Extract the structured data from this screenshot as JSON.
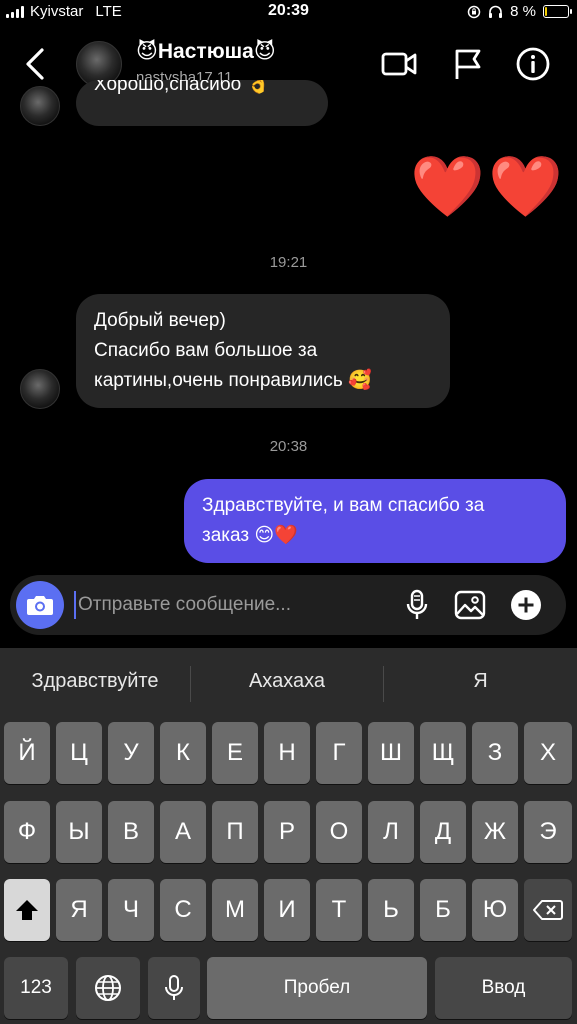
{
  "status_bar": {
    "carrier": "Kyivstar",
    "network": "LTE",
    "time": "20:39",
    "battery_text": "8 %",
    "battery_level_percent": 8
  },
  "header": {
    "contact_name": "😈Настюша😈",
    "contact_handle": "nastysha17.11"
  },
  "chat": {
    "partial_message": "Хорошо,спасибо 👌",
    "hearts": "❤️",
    "time_1": "19:21",
    "incoming_line1": "Добрый вечер)",
    "incoming_line2": "Спасибо вам большое за",
    "incoming_line3": "картины,очень понравились 🥰",
    "time_2": "20:38",
    "outgoing_line1": "Здравствуйте, и вам спасибо за",
    "outgoing_line2": "заказ 😊❤️"
  },
  "composer": {
    "placeholder": "Отправьте сообщение..."
  },
  "keyboard": {
    "suggestions": [
      "Здравствуйте",
      "Ахахаха",
      "Я"
    ],
    "row1": [
      "Й",
      "Ц",
      "У",
      "К",
      "Е",
      "Н",
      "Г",
      "Ш",
      "Щ",
      "З",
      "Х"
    ],
    "row2": [
      "Ф",
      "Ы",
      "В",
      "А",
      "П",
      "Р",
      "О",
      "Л",
      "Д",
      "Ж",
      "Э"
    ],
    "row3": [
      "Я",
      "Ч",
      "С",
      "М",
      "И",
      "Т",
      "Ь",
      "Б",
      "Ю"
    ],
    "numbers_key": "123",
    "space_key": "Пробел",
    "return_key": "Ввод"
  },
  "icons": {
    "back": "chevron-left-icon",
    "video": "video-camera-icon",
    "flag": "flag-icon",
    "info": "info-icon",
    "camera": "camera-icon",
    "mic": "microphone-icon",
    "gallery": "image-icon",
    "add": "plus-circle-icon",
    "shift": "shift-icon",
    "delete": "backspace-icon",
    "globe": "globe-icon",
    "dictation": "microphone-icon"
  },
  "colors": {
    "accent": "#5b6ff2",
    "outgoing_bubble": "#5a4ee6",
    "incoming_bubble": "#262626",
    "background": "#000000"
  }
}
